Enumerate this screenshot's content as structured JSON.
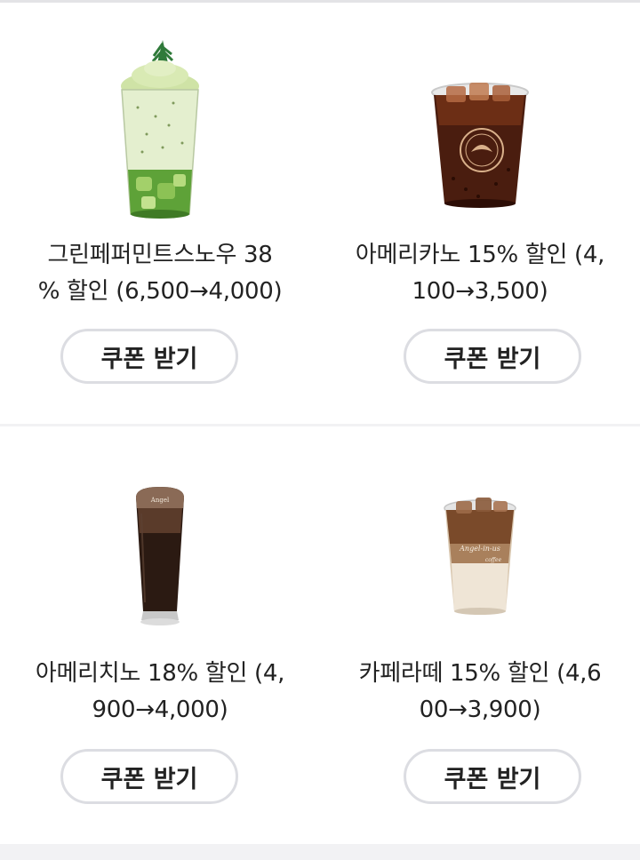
{
  "products": [
    {
      "name": "그린페퍼민트스노우 38 % 할인 (6,500→4,000)",
      "title_line1": "그린페퍼민트스노우 38",
      "title_line2": "% 할인 (6,500→4,000)",
      "button_label": "쿠폰 받기",
      "image_icon": "green-peppermint-snow-drink-image"
    },
    {
      "name": "아메리카노 15% 할인 (4,100→3,500)",
      "title_line1": "아메리카노 15% 할인 (4,",
      "title_line2": "100→3,500)",
      "button_label": "쿠폰 받기",
      "image_icon": "iced-americano-drink-image"
    },
    {
      "name": "아메리치노 18% 할인 (4,900→4,000)",
      "title_line1": "아메리치노 18% 할인 (4,",
      "title_line2": "900→4,000)",
      "button_label": "쿠폰 받기",
      "image_icon": "americhino-drink-image"
    },
    {
      "name": "카페라떼 15% 할인 (4,600→3,900)",
      "title_line1": "카페라떼 15% 할인 (4,6",
      "title_line2": "00→3,900)",
      "button_label": "쿠폰 받기",
      "image_icon": "iced-cafe-latte-drink-image"
    }
  ],
  "colors": {
    "background": "#f2f2f4",
    "card": "#ffffff",
    "button_border": "#dcdde2",
    "text": "#222222"
  }
}
